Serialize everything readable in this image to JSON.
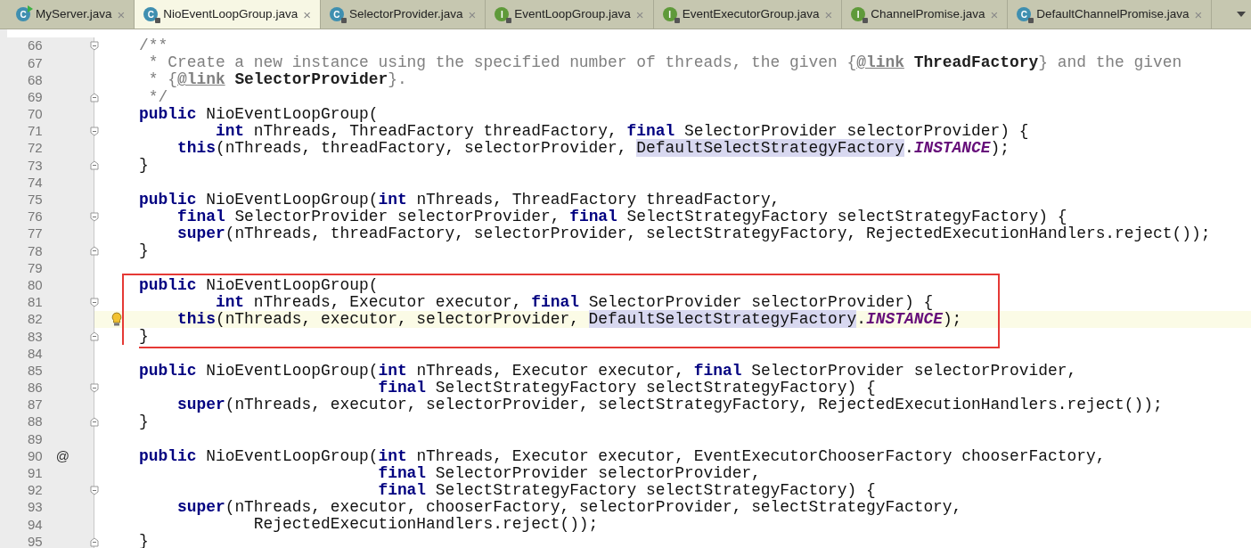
{
  "tabs": [
    {
      "label": "MyServer.java",
      "kind": "class",
      "badge": "C",
      "runnable": true,
      "locked": false,
      "selected": false,
      "close": "×"
    },
    {
      "label": "NioEventLoopGroup.java",
      "kind": "class",
      "badge": "C",
      "runnable": false,
      "locked": true,
      "selected": true,
      "close": "×"
    },
    {
      "label": "SelectorProvider.java",
      "kind": "class",
      "badge": "C",
      "runnable": false,
      "locked": true,
      "selected": false,
      "close": "×"
    },
    {
      "label": "EventLoopGroup.java",
      "kind": "interface",
      "badge": "I",
      "runnable": false,
      "locked": true,
      "selected": false,
      "close": "×"
    },
    {
      "label": "EventExecutorGroup.java",
      "kind": "interface",
      "badge": "I",
      "runnable": false,
      "locked": true,
      "selected": false,
      "close": "×"
    },
    {
      "label": "ChannelPromise.java",
      "kind": "interface",
      "badge": "I",
      "runnable": false,
      "locked": true,
      "selected": false,
      "close": "×"
    },
    {
      "label": "DefaultChannelPromise.java",
      "kind": "class",
      "badge": "C",
      "runnable": false,
      "locked": true,
      "selected": false,
      "close": "×"
    }
  ],
  "lines": [
    {
      "number": "66",
      "fold_start": true,
      "fold_end": false,
      "segments": [
        {
          "kind": "cm",
          "text": "/**"
        }
      ]
    },
    {
      "number": "67",
      "fold_start": false,
      "fold_end": false,
      "segments": [
        {
          "kind": "cm",
          "text": " * Create a new instance using the specified number of threads, the given {"
        },
        {
          "kind": "tag",
          "text": "@link"
        },
        {
          "kind": "ref",
          "text": " ThreadFactory"
        },
        {
          "kind": "cm",
          "text": "} and the given"
        }
      ]
    },
    {
      "number": "68",
      "fold_start": false,
      "fold_end": false,
      "segments": [
        {
          "kind": "cm",
          "text": " * {"
        },
        {
          "kind": "tag",
          "text": "@link"
        },
        {
          "kind": "ref",
          "text": " SelectorProvider"
        },
        {
          "kind": "cm",
          "text": "}."
        }
      ]
    },
    {
      "number": "69",
      "fold_start": false,
      "fold_end": true,
      "segments": [
        {
          "kind": "cm",
          "text": " */"
        }
      ]
    },
    {
      "number": "70",
      "fold_start": false,
      "fold_end": false,
      "segments": [
        {
          "kind": "kw",
          "text": "public"
        },
        {
          "kind": "tx",
          "text": " NioEventLoopGroup("
        }
      ]
    },
    {
      "number": "71",
      "fold_start": true,
      "fold_end": false,
      "segments": [
        {
          "kind": "kw",
          "text": "        int"
        },
        {
          "kind": "tx",
          "text": " nThreads, ThreadFactory threadFactory, "
        },
        {
          "kind": "kw",
          "text": "final"
        },
        {
          "kind": "tx",
          "text": " SelectorProvider selectorProvider) {"
        }
      ]
    },
    {
      "number": "72",
      "fold_start": false,
      "fold_end": false,
      "segments": [
        {
          "kind": "kw",
          "text": "    this"
        },
        {
          "kind": "tx",
          "text": "(nThreads, threadFactory, selectorProvider, "
        },
        {
          "kind": "hl",
          "text": "DefaultSelectStrategyFactory"
        },
        {
          "kind": "tx",
          "text": "."
        },
        {
          "kind": "const",
          "text": "INSTANCE"
        },
        {
          "kind": "tx",
          "text": ");"
        }
      ]
    },
    {
      "number": "73",
      "fold_start": false,
      "fold_end": true,
      "segments": [
        {
          "kind": "tx",
          "text": "}"
        }
      ]
    },
    {
      "number": "74",
      "fold_start": false,
      "fold_end": false
    },
    {
      "number": "75",
      "fold_start": false,
      "fold_end": false,
      "segments": [
        {
          "kind": "kw",
          "text": "public"
        },
        {
          "kind": "tx",
          "text": " NioEventLoopGroup("
        },
        {
          "kind": "kw",
          "text": "int"
        },
        {
          "kind": "tx",
          "text": " nThreads, ThreadFactory threadFactory,"
        }
      ]
    },
    {
      "number": "76",
      "fold_start": true,
      "fold_end": false,
      "segments": [
        {
          "kind": "kw",
          "text": "    final"
        },
        {
          "kind": "tx",
          "text": " SelectorProvider selectorProvider, "
        },
        {
          "kind": "kw",
          "text": "final"
        },
        {
          "kind": "tx",
          "text": " SelectStrategyFactory selectStrategyFactory) {"
        }
      ]
    },
    {
      "number": "77",
      "fold_start": false,
      "fold_end": false,
      "segments": [
        {
          "kind": "kw",
          "text": "    super"
        },
        {
          "kind": "tx",
          "text": "(nThreads, threadFactory, selectorProvider, selectStrategyFactory, RejectedExecutionHandlers.reject());"
        }
      ]
    },
    {
      "number": "78",
      "fold_start": false,
      "fold_end": true,
      "segments": [
        {
          "kind": "tx",
          "text": "}"
        }
      ]
    },
    {
      "number": "79",
      "fold_start": false,
      "fold_end": false
    },
    {
      "number": "80",
      "boxed": true,
      "fold_start": false,
      "fold_end": false,
      "segments": [
        {
          "kind": "kw",
          "text": "public"
        },
        {
          "kind": "tx",
          "text": " NioEventLoopGroup("
        }
      ]
    },
    {
      "number": "81",
      "boxed": true,
      "fold_start": true,
      "fold_end": false,
      "segments": [
        {
          "kind": "kw",
          "text": "        int"
        },
        {
          "kind": "tx",
          "text": " nThreads, Executor executor, "
        },
        {
          "kind": "kw",
          "text": "final"
        },
        {
          "kind": "tx",
          "text": " SelectorProvider selectorProvider) {"
        }
      ]
    },
    {
      "number": "82",
      "boxed": true,
      "current": true,
      "bulb": true,
      "fold_start": false,
      "fold_end": false,
      "segments": [
        {
          "kind": "kw",
          "text": "    this"
        },
        {
          "kind": "tx",
          "text": "(nThreads, executor, selectorProvider, "
        },
        {
          "kind": "hl",
          "text": "DefaultSelectStrategyFactory"
        },
        {
          "kind": "tx",
          "text": "."
        },
        {
          "kind": "const",
          "text": "INSTANCE"
        },
        {
          "kind": "tx",
          "text": ");"
        }
      ]
    },
    {
      "number": "83",
      "boxed": true,
      "fold_start": false,
      "fold_end": true,
      "segments": [
        {
          "kind": "tx",
          "text": "}"
        }
      ]
    },
    {
      "number": "84",
      "fold_start": false,
      "fold_end": false
    },
    {
      "number": "85",
      "fold_start": false,
      "fold_end": false,
      "segments": [
        {
          "kind": "kw",
          "text": "public"
        },
        {
          "kind": "tx",
          "text": " NioEventLoopGroup("
        },
        {
          "kind": "kw",
          "text": "int"
        },
        {
          "kind": "tx",
          "text": " nThreads, Executor executor, "
        },
        {
          "kind": "kw",
          "text": "final"
        },
        {
          "kind": "tx",
          "text": " SelectorProvider selectorProvider,"
        }
      ]
    },
    {
      "number": "86",
      "fold_start": true,
      "fold_end": false,
      "segments": [
        {
          "kind": "kw",
          "text": "                         final"
        },
        {
          "kind": "tx",
          "text": " SelectStrategyFactory selectStrategyFactory) {"
        }
      ]
    },
    {
      "number": "87",
      "fold_start": false,
      "fold_end": false,
      "segments": [
        {
          "kind": "kw",
          "text": "    super"
        },
        {
          "kind": "tx",
          "text": "(nThreads, executor, selectorProvider, selectStrategyFactory, RejectedExecutionHandlers.reject());"
        }
      ]
    },
    {
      "number": "88",
      "fold_start": false,
      "fold_end": true,
      "segments": [
        {
          "kind": "tx",
          "text": "}"
        }
      ]
    },
    {
      "number": "89",
      "fold_start": false,
      "fold_end": false
    },
    {
      "number": "90",
      "marker": "@",
      "fold_start": false,
      "fold_end": false,
      "segments": [
        {
          "kind": "kw",
          "text": "public"
        },
        {
          "kind": "tx",
          "text": " NioEventLoopGroup("
        },
        {
          "kind": "kw",
          "text": "int"
        },
        {
          "kind": "tx",
          "text": " nThreads, Executor executor, EventExecutorChooserFactory chooserFactory,"
        }
      ]
    },
    {
      "number": "91",
      "fold_start": false,
      "fold_end": false,
      "segments": [
        {
          "kind": "kw",
          "text": "                         final"
        },
        {
          "kind": "tx",
          "text": " SelectorProvider selectorProvider,"
        }
      ]
    },
    {
      "number": "92",
      "fold_start": true,
      "fold_end": false,
      "segments": [
        {
          "kind": "kw",
          "text": "                         final"
        },
        {
          "kind": "tx",
          "text": " SelectStrategyFactory selectStrategyFactory) {"
        }
      ]
    },
    {
      "number": "93",
      "fold_start": false,
      "fold_end": false,
      "segments": [
        {
          "kind": "kw",
          "text": "    super"
        },
        {
          "kind": "tx",
          "text": "(nThreads, executor, chooserFactory, selectorProvider, selectStrategyFactory,"
        }
      ]
    },
    {
      "number": "94",
      "fold_start": false,
      "fold_end": false,
      "segments": [
        {
          "kind": "tx",
          "text": "            RejectedExecutionHandlers.reject());"
        }
      ]
    },
    {
      "number": "95",
      "fold_start": false,
      "fold_end": true,
      "segments": [
        {
          "kind": "tx",
          "text": "}"
        }
      ]
    }
  ]
}
